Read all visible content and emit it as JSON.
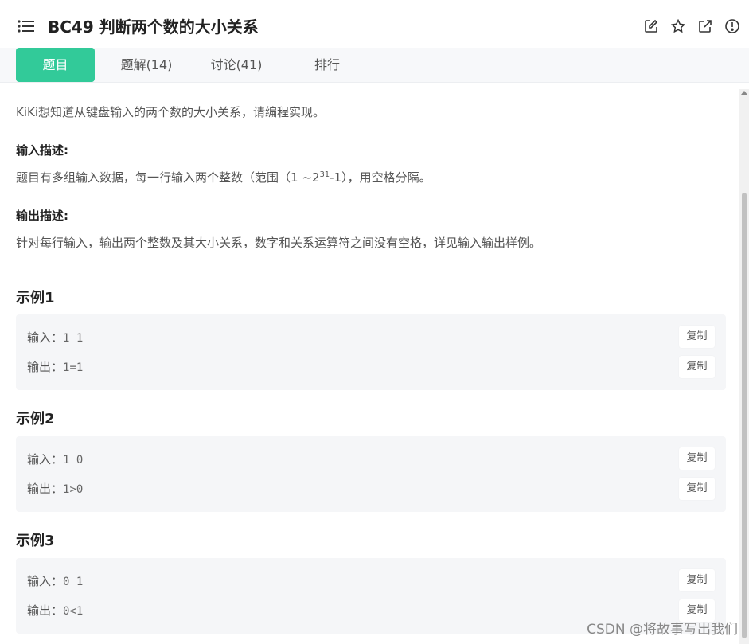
{
  "header": {
    "title": "BC49  判断两个数的大小关系",
    "icons": [
      "list-menu-icon",
      "edit-icon",
      "star-icon",
      "external-link-icon",
      "report-icon"
    ]
  },
  "tabs": [
    {
      "label": "题目",
      "active": true
    },
    {
      "label": "题解(14)",
      "active": false
    },
    {
      "label": "讨论(41)",
      "active": false
    },
    {
      "label": "排行",
      "active": false
    }
  ],
  "description": {
    "intro": "KiKi想知道从键盘输入的两个数的大小关系，请编程实现。",
    "input_heading": "输入描述:",
    "input_text_before": "题目有多组输入数据，每一行输入两个整数（范围（1 ~2",
    "input_sup": "31",
    "input_text_after": "-1），用空格分隔。",
    "output_heading": "输出描述:",
    "output_text": "针对每行输入，输出两个整数及其大小关系，数字和关系运算符之间没有空格，详见输入输出样例。"
  },
  "examples": [
    {
      "title": "示例1",
      "input_label": "输入：",
      "input": "1 1",
      "output_label": "输出：",
      "output": "1=1",
      "copy_label": "复制"
    },
    {
      "title": "示例2",
      "input_label": "输入：",
      "input": "1 0",
      "output_label": "输出：",
      "output": "1>0",
      "copy_label": "复制"
    },
    {
      "title": "示例3",
      "input_label": "输入：",
      "input": "0 1",
      "output_label": "输出：",
      "output": "0<1",
      "copy_label": "复制"
    }
  ],
  "watermark": "CSDN @将故事写出我们",
  "colors": {
    "accent": "#32ca99",
    "tab_bg": "#f7f8fa",
    "example_bg": "#f5f6f8"
  }
}
